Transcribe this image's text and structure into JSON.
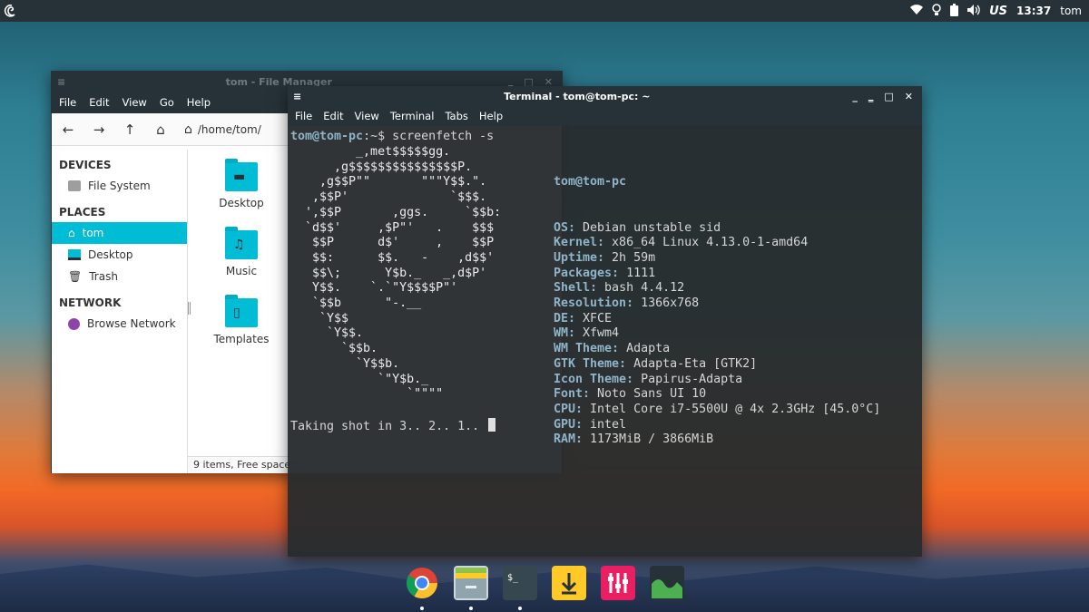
{
  "panel": {
    "keyboard_layout": "US",
    "time": "13:37",
    "user": "tom"
  },
  "file_manager": {
    "title": "tom - File Manager",
    "menu": [
      "File",
      "Edit",
      "View",
      "Go",
      "Help"
    ],
    "path": "/home/tom/",
    "sidebar": {
      "devices_header": "DEVICES",
      "devices": [
        "File System"
      ],
      "places_header": "PLACES",
      "places": [
        "tom",
        "Desktop",
        "Trash"
      ],
      "network_header": "NETWORK",
      "network": [
        "Browse Network"
      ]
    },
    "items": [
      "Desktop",
      "Music",
      "Templates"
    ],
    "status": "9 items, Free space: "
  },
  "terminal": {
    "title": "Terminal - tom@tom-pc: ~",
    "menu": [
      "File",
      "Edit",
      "View",
      "Terminal",
      "Tabs",
      "Help"
    ],
    "prompt_user": "tom@tom-pc",
    "prompt_rest": ":~$ screenfetch -s",
    "ascii_logo": "         _,met$$$$$gg.\n      ,g$$$$$$$$$$$$$$$P.\n    ,g$$P\"\"       \"\"\"Y$$.\".\n   ,$$P'              `$$$.\n  ',$$P       ,ggs.     `$$b:\n  `d$$'     ,$P\"'   .    $$$\n   $$P      d$'     ,    $$P\n   $$:      $$.   -    ,d$$'\n   $$\\;      Y$b._   _,d$P'\n   Y$$.    `.`\"Y$$$$P\"'\n   `$$b      \"-.__\n    `Y$$\n     `Y$$.\n       `$$b.\n         `Y$$b.\n            `\"Y$b._\n                `\"\"\"\"",
    "host": "tom@tom-pc",
    "info": [
      {
        "key": "OS:",
        "value": " Debian unstable sid"
      },
      {
        "key": "Kernel:",
        "value": " x86_64 Linux 4.13.0-1-amd64"
      },
      {
        "key": "Uptime:",
        "value": " 2h 59m"
      },
      {
        "key": "Packages:",
        "value": " 1111"
      },
      {
        "key": "Shell:",
        "value": " bash 4.4.12"
      },
      {
        "key": "Resolution:",
        "value": " 1366x768"
      },
      {
        "key": "DE:",
        "value": " XFCE"
      },
      {
        "key": "WM:",
        "value": " Xfwm4"
      },
      {
        "key": "WM Theme:",
        "value": " Adapta"
      },
      {
        "key": "GTK Theme:",
        "value": " Adapta-Eta [GTK2]"
      },
      {
        "key": "Icon Theme:",
        "value": " Papirus-Adapta"
      },
      {
        "key": "Font:",
        "value": " Noto Sans UI 10"
      },
      {
        "key": "CPU:",
        "value": " Intel Core i7-5500U @ 4x 2.3GHz [45.0°C]"
      },
      {
        "key": "GPU:",
        "value": " intel"
      },
      {
        "key": "RAM:",
        "value": " 1173MiB / 3866MiB"
      }
    ],
    "shot_line": "Taking shot in 3.. 2.. 1.. "
  },
  "dock": {
    "items": [
      "chrome-icon",
      "file-manager-icon",
      "terminal-icon",
      "downloader-icon",
      "mixer-icon",
      "system-monitor-icon"
    ],
    "colors": [
      "#ffffff",
      "#8bc34a",
      "#37474f",
      "#ffca28",
      "#e91e63",
      "#263238"
    ]
  }
}
